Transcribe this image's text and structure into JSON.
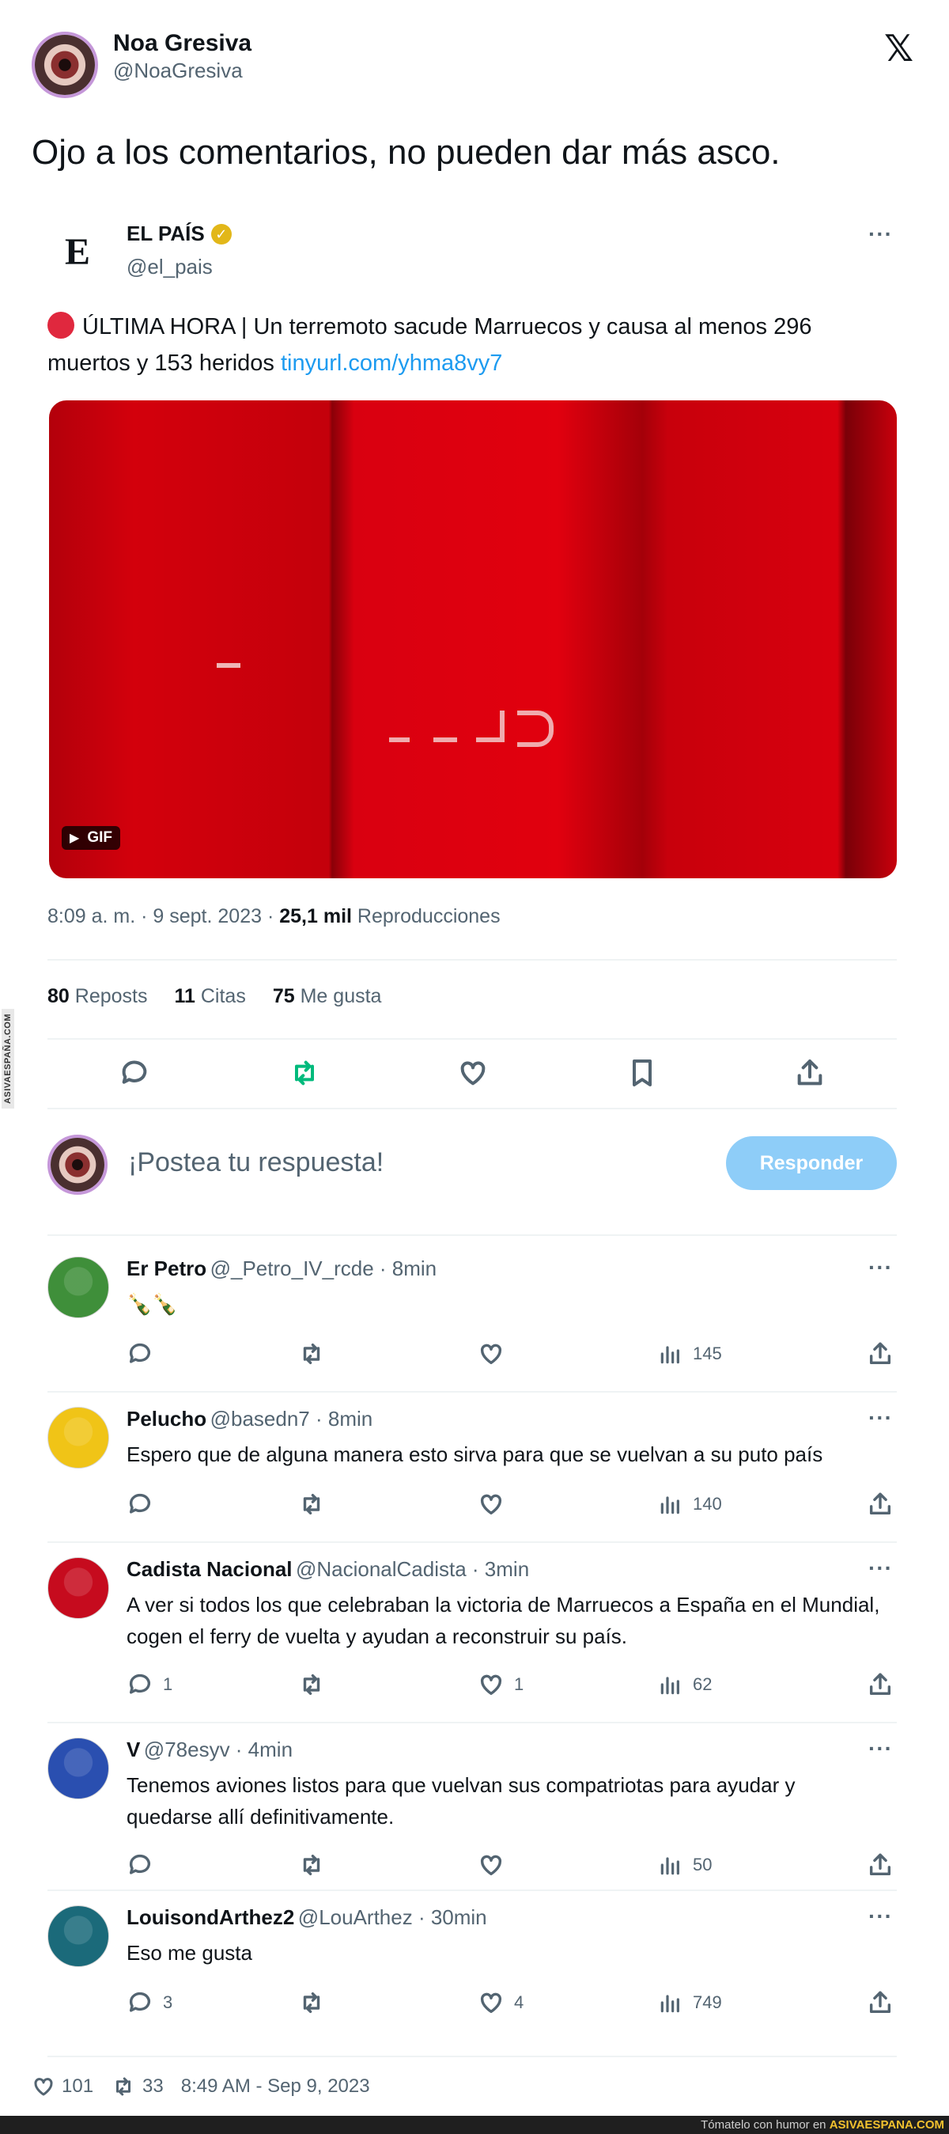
{
  "author": {
    "name": "Noa Gresiva",
    "handle": "@NoaGresiva",
    "text": "Ojo a los comentarios, no pueden dar más asco."
  },
  "side_tag": "ASIVAESPAÑA.COM",
  "quoted": {
    "name": "EL PAÍS",
    "handle": "@el_pais",
    "logo_letter": "E",
    "text_prefix": "ÚLTIMA HORA | Un terremoto sacude Marruecos y causa al menos 296 muertos y 153 heridos",
    "link": "tinyurl.com/yhma8vy7",
    "gif_label": "GIF",
    "meta_time": "8:09 a. m. · 9 sept. 2023 ·",
    "views_value": "25,1 mil",
    "views_label": "Reproducciones",
    "reposts_value": "80",
    "reposts_label": "Reposts",
    "quotes_value": "11",
    "quotes_label": "Citas",
    "likes_value": "75",
    "likes_label": "Me gusta",
    "more": "···"
  },
  "compose": {
    "placeholder": "¡Postea tu respuesta!",
    "button": "Responder"
  },
  "replies": [
    {
      "name": "Er Petro",
      "handle": "@_Petro_IV_rcde · 8min",
      "text": "🍾🍾",
      "replies": "",
      "likes": "",
      "views": "145",
      "avatar_color": "#3f8f3a"
    },
    {
      "name": "Pelucho",
      "handle": "@basedn7 · 8min",
      "text": "Espero que de alguna manera esto sirva para que se vuelvan a su puto país",
      "replies": "",
      "likes": "",
      "views": "140",
      "avatar_color": "#f0c417"
    },
    {
      "name": "Cadista Nacional",
      "handle": "@NacionalCadista · 3min",
      "text": "A ver si todos los que celebraban la victoria de Marruecos a España en el Mundial, cogen el ferry de vuelta y ayudan a reconstruir su país.",
      "replies": "1",
      "likes": "1",
      "views": "62",
      "avatar_color": "#c60b1e"
    },
    {
      "name": "V",
      "handle": "@78esyv · 4min",
      "text": "Tenemos aviones listos para que vuelvan sus compatriotas para ayudar y quedarse allí definitivamente.",
      "replies": "",
      "likes": "",
      "views": "50",
      "avatar_color": "#2a4fb0"
    },
    {
      "name": "LouisondArthez2",
      "handle": "@LouArthez · 30min",
      "text": "Eso me gusta",
      "replies": "3",
      "likes": "4",
      "views": "749",
      "avatar_color": "#1b6a7a"
    }
  ],
  "footer": {
    "likes": "101",
    "retweets": "33",
    "timestamp": "8:49 AM - Sep 9, 2023"
  },
  "watermark": {
    "prefix": "Tómatelo con humor en",
    "site": "ASIVAESPANA.COM"
  },
  "colors": {
    "link": "#1d9bf0",
    "repost_active": "#00ba7c",
    "reply_button": "#8ecdf8",
    "gif_red": "#d3000c"
  }
}
